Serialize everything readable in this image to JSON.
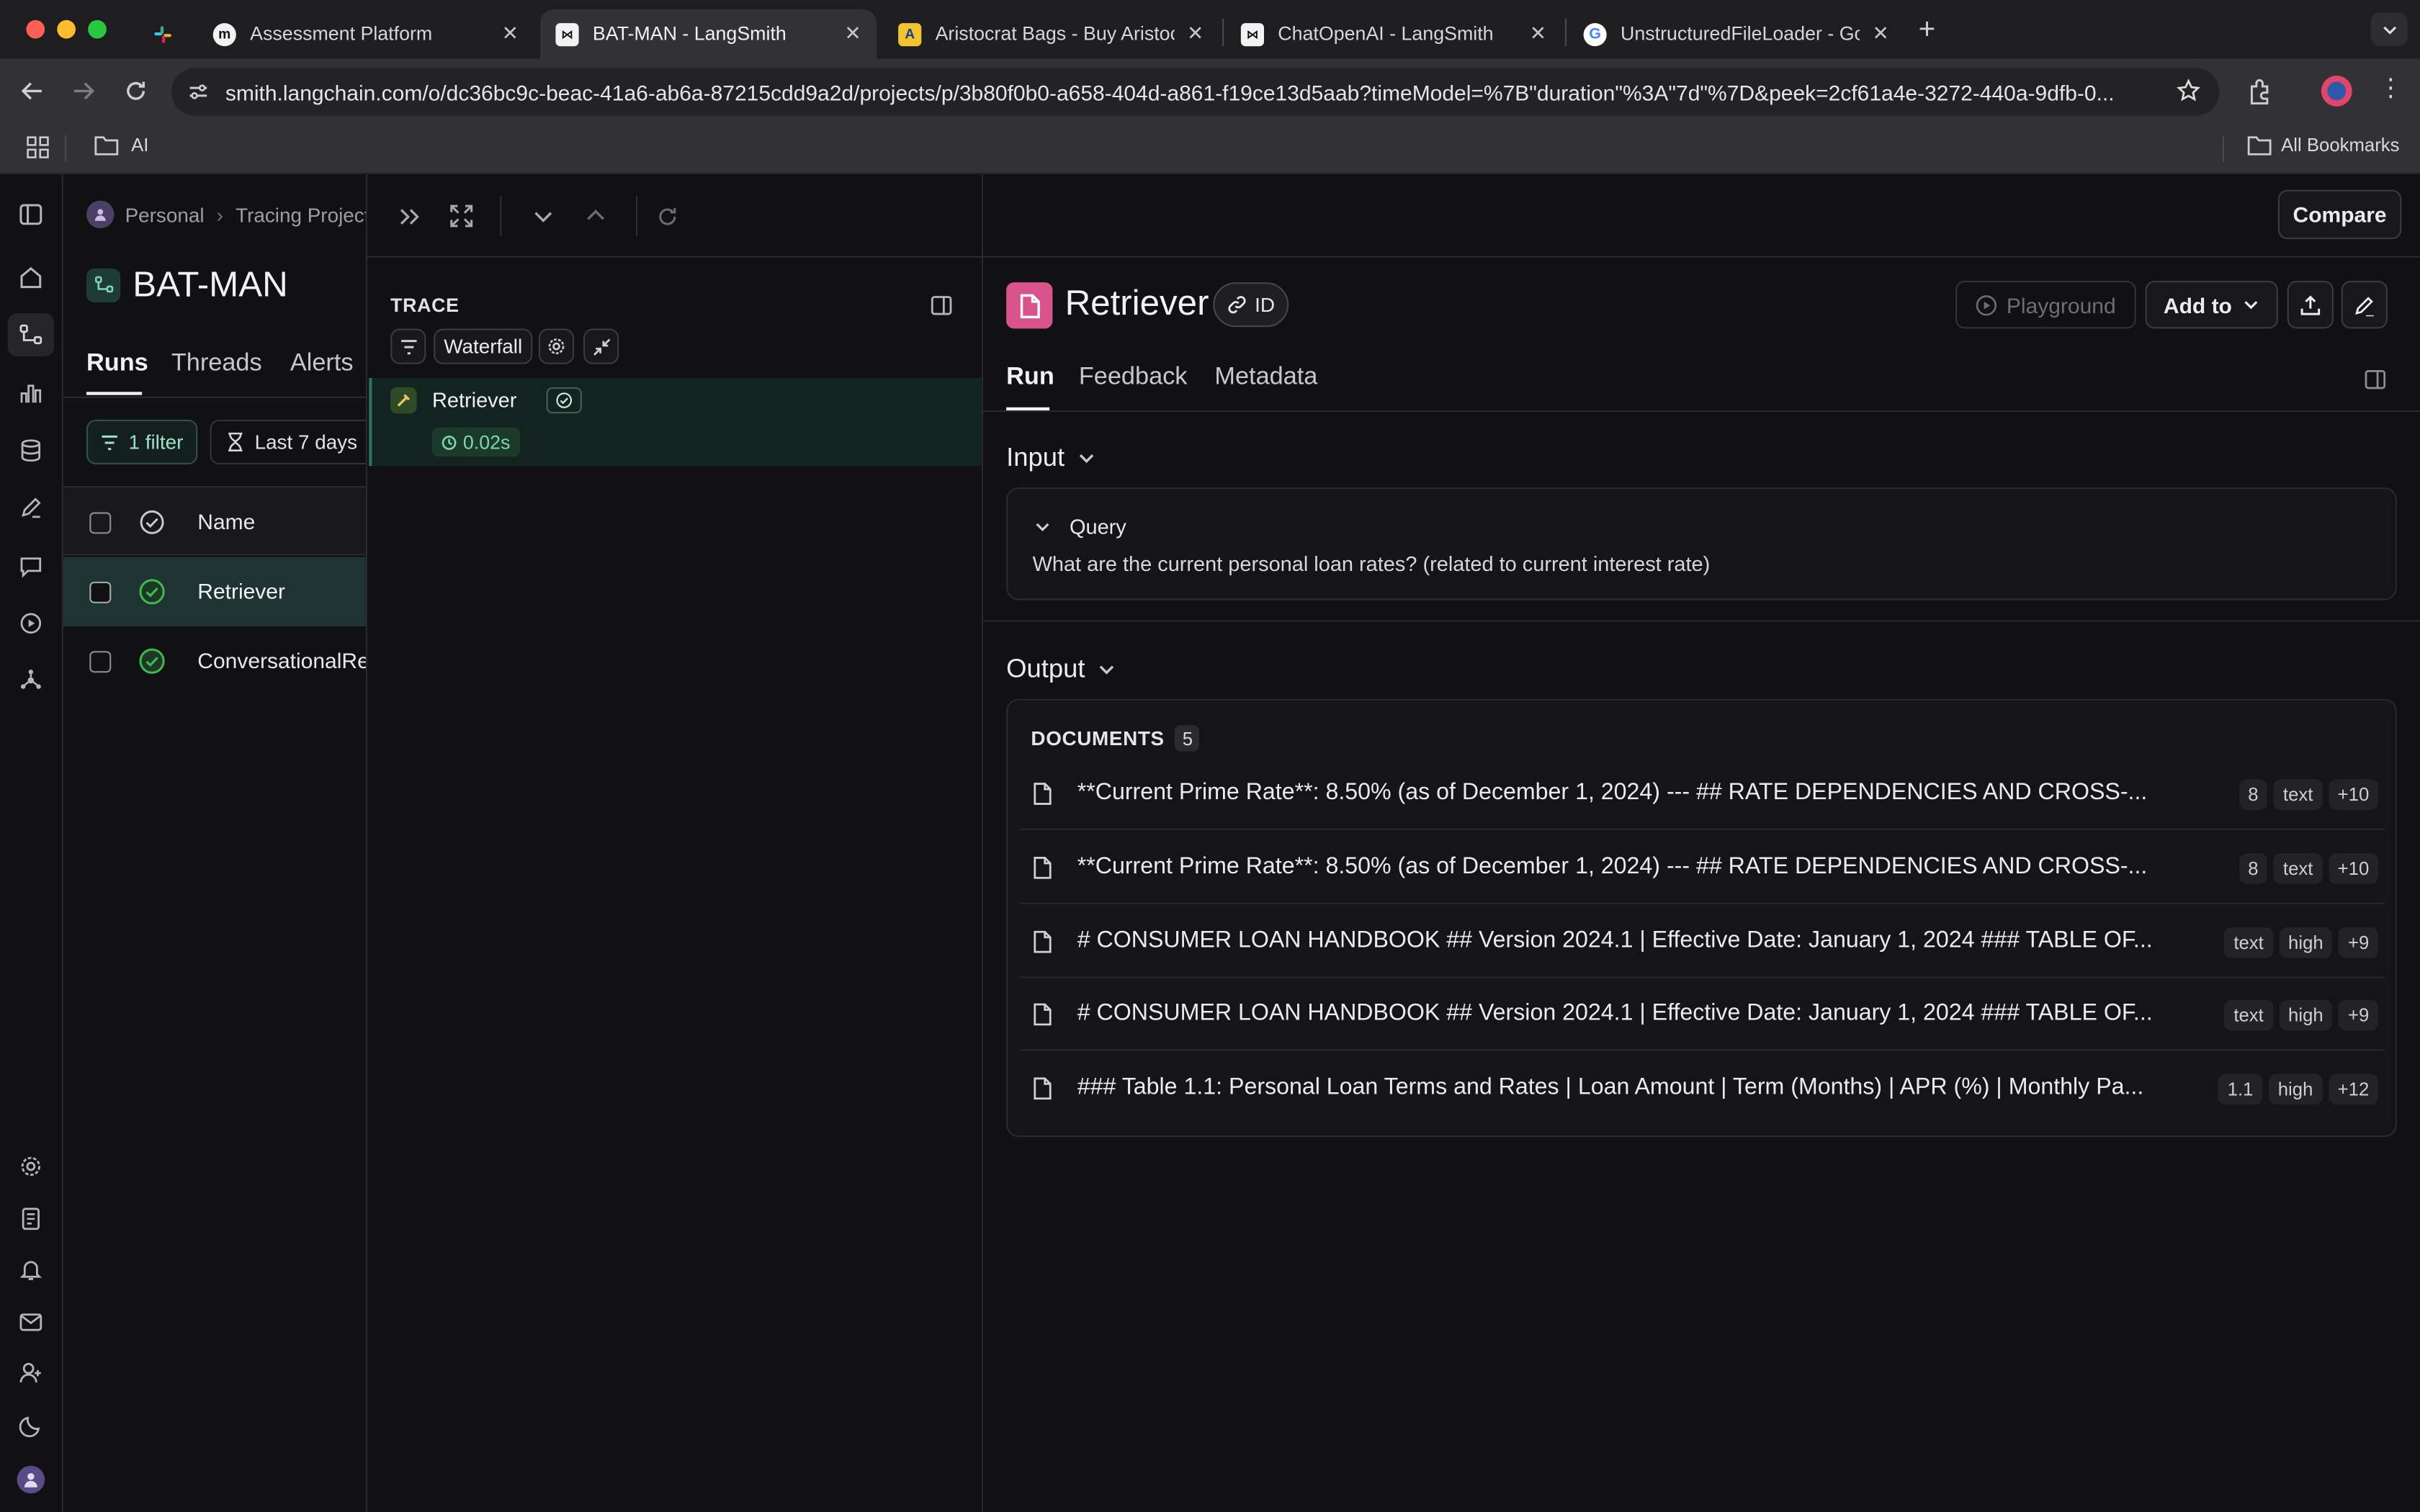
{
  "browser": {
    "tabs": [
      {
        "title": "",
        "favicon": "slack-icon"
      },
      {
        "title": "Assessment Platform",
        "favicon": "m-logo-icon"
      },
      {
        "title": "BAT-MAN - LangSmith",
        "favicon": "langsmith-icon",
        "active": true
      },
      {
        "title": "Aristocrat Bags - Buy Aristocr",
        "favicon": "aristocrat-icon"
      },
      {
        "title": "ChatOpenAI - LangSmith",
        "favicon": "langsmith-icon"
      },
      {
        "title": "UnstructuredFileLoader - Goo",
        "favicon": "google-icon"
      }
    ],
    "url": "smith.langchain.com/o/dc36bc9c-beac-41a6-ab6a-87215cdd9a2d/projects/p/3b80f0b0-a658-404d-a861-f19ce13d5aab?timeModel=%7B\"duration\"%3A\"7d\"%7D&peek=2cf61a4e-3272-440a-9dfb-0...",
    "bookmarks": {
      "folder": "AI",
      "all": "All Bookmarks"
    }
  },
  "left": {
    "breadcrumb": {
      "workspace": "Personal",
      "section": "Tracing Projects"
    },
    "project_title": "BAT-MAN",
    "tabs": [
      "Runs",
      "Threads",
      "Alerts"
    ],
    "filter_label": "1 filter",
    "time_label": "Last 7 days",
    "table": {
      "header": "Name",
      "rows": [
        {
          "name": "Retriever",
          "status": "success",
          "selected": true
        },
        {
          "name": "ConversationalRetrievalChain",
          "status": "success",
          "selected": false
        }
      ]
    }
  },
  "top": {
    "compare_label": "Compare"
  },
  "trace": {
    "label": "TRACE",
    "view_label": "Waterfall",
    "node": {
      "name": "Retriever",
      "duration": "0.02s"
    }
  },
  "detail": {
    "title": "Retriever",
    "id_label": "ID",
    "playground_label": "Playground",
    "add_to_label": "Add to",
    "tabs": [
      "Run",
      "Feedback",
      "Metadata"
    ],
    "input": {
      "header": "Input",
      "field": "Query",
      "value": "What are the current personal loan rates? (related to current interest rate)"
    },
    "output": {
      "header": "Output",
      "documents_label": "DOCUMENTS",
      "documents_count": "5",
      "documents": [
        {
          "text": "**Current Prime Rate**: 8.50% (as of December 1, 2024) --- ## RATE DEPENDENCIES AND CROSS-...",
          "chips": [
            "8",
            "text",
            "+10"
          ]
        },
        {
          "text": "**Current Prime Rate**: 8.50% (as of December 1, 2024) --- ## RATE DEPENDENCIES AND CROSS-...",
          "chips": [
            "8",
            "text",
            "+10"
          ]
        },
        {
          "text": "# CONSUMER LOAN HANDBOOK ## Version 2024.1 | Effective Date: January 1, 2024 ### TABLE OF...",
          "chips": [
            "text",
            "high",
            "+9"
          ]
        },
        {
          "text": "# CONSUMER LOAN HANDBOOK ## Version 2024.1 | Effective Date: January 1, 2024 ### TABLE OF...",
          "chips": [
            "text",
            "high",
            "+9"
          ]
        },
        {
          "text": "### Table 1.1: Personal Loan Terms and Rates | Loan Amount | Term (Months) | APR (%) | Monthly Pa...",
          "chips": [
            "1.1",
            "high",
            "+12"
          ]
        }
      ]
    }
  },
  "colors": {
    "accent_green": "#3fb950",
    "retriever_pink": "#d9538d",
    "selected_row": "#1f3432",
    "trace_selected": "#132420"
  }
}
